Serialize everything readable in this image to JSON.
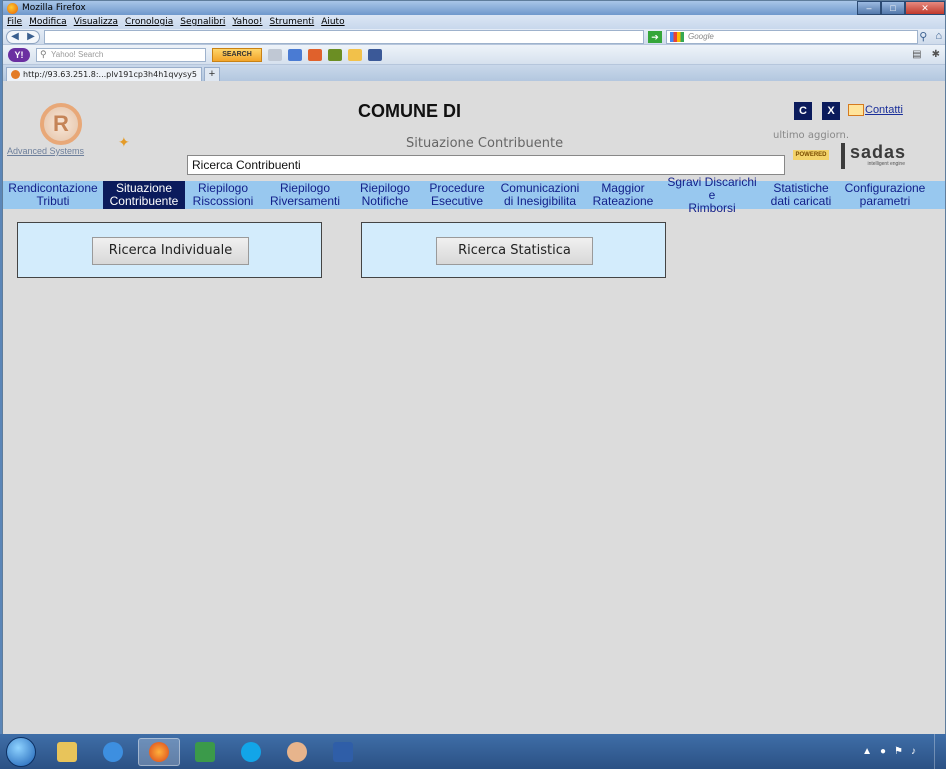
{
  "window": {
    "title": "Mozilla Firefox",
    "menu": [
      "File",
      "Modifica",
      "Visualizza",
      "Cronologia",
      "Segnalibri",
      "Yahoo!",
      "Strumenti",
      "Aiuto"
    ],
    "search_placeholder": "Google",
    "yahoo_search_placeholder": "Yahoo! Search",
    "yahoo_search_button": "SEARCH",
    "tab_label": "http://93.63.251.8:...plv191cp3h4h1qvysy5",
    "new_tab": "+"
  },
  "header": {
    "logo_letter": "R",
    "logo_caption": "Advanced Systems",
    "title": "COMUNE DI",
    "subtitle": "Situazione Contribuente",
    "btn_c": "C",
    "btn_x": "X",
    "contatti": "Contatti",
    "last_update": "ultimo aggiorn.",
    "powered": "POWERED",
    "brand": "sadas",
    "brand_tagline": "intelligent engine",
    "search_value": "Ricerca Contribuenti"
  },
  "menu": [
    {
      "label": "Rendicontazione\nTributi",
      "active": false
    },
    {
      "label": "Situazione\nContribuente",
      "active": true
    },
    {
      "label": "Riepilogo\nRiscossioni",
      "active": false
    },
    {
      "label": "Riepilogo\nRiversamenti",
      "active": false
    },
    {
      "label": "Riepilogo\nNotifiche",
      "active": false
    },
    {
      "label": "Procedure\nEsecutive",
      "active": false
    },
    {
      "label": "Comunicazioni\ndi Inesigibilita",
      "active": false
    },
    {
      "label": "Maggior\nRateazione",
      "active": false
    },
    {
      "label": "Sgravi Discarichi e\nRimborsi",
      "active": false
    },
    {
      "label": "Statistiche\ndati caricati",
      "active": false
    },
    {
      "label": "Configurazione\nparametri",
      "active": false
    }
  ],
  "panels": {
    "individual_button": "Ricerca Individuale",
    "statistic_button": "Ricerca Statistica"
  },
  "colors": {
    "menu_bg": "#98c8ef",
    "menu_active": "#0b1b5c",
    "panel_bg": "#d3ecfc",
    "page_bg": "#dcdcdc"
  }
}
